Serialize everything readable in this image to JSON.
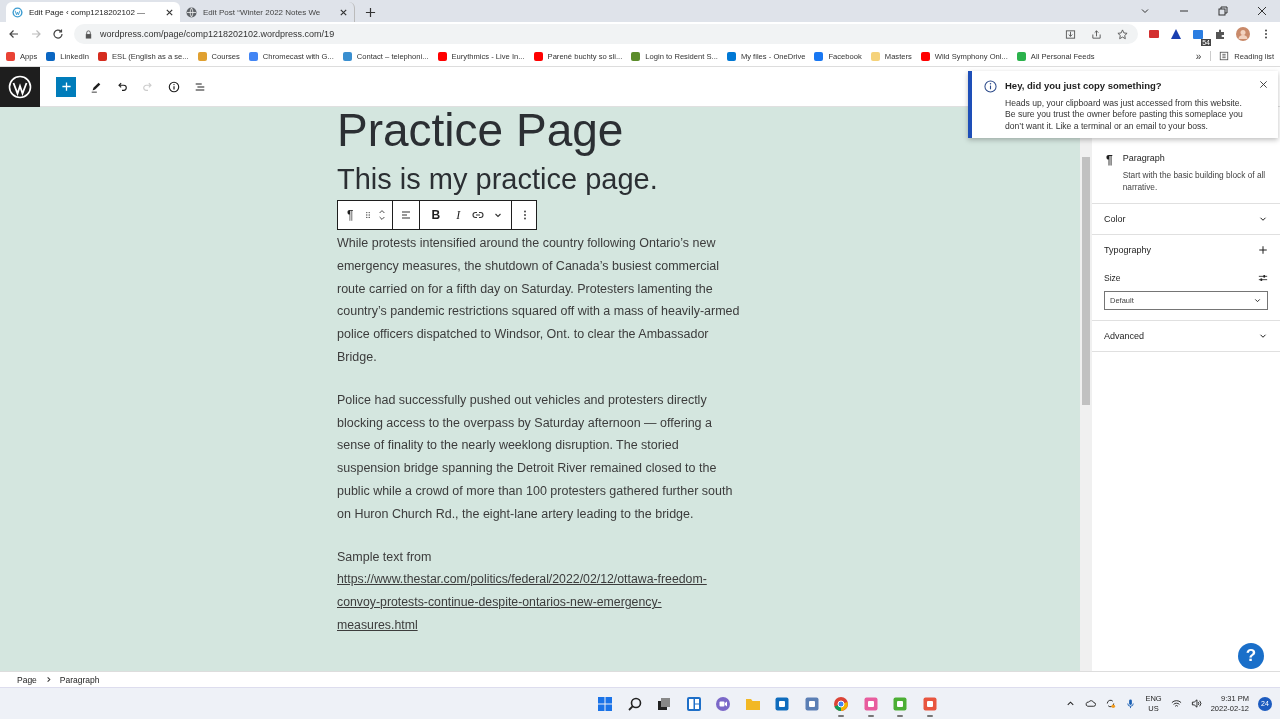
{
  "browser": {
    "tabs": [
      {
        "title": "Edit Page ‹ comp1218202102 —",
        "selected": true,
        "kind": "wp"
      },
      {
        "title": "Edit Post “Winter 2022 Notes We",
        "selected": false,
        "kind": "globe"
      }
    ],
    "url": "wordpress.com/page/comp1218202102.wordpress.com/19",
    "extension_badge": "54",
    "bookmarks": [
      {
        "label": "Apps",
        "color": "#e94235"
      },
      {
        "label": "LinkedIn",
        "color": "#0a66c2"
      },
      {
        "label": "ESL (English as a se...",
        "color": "#d52b1e"
      },
      {
        "label": "Courses",
        "color": "#e0a030"
      },
      {
        "label": "Chromecast with G...",
        "color": "#4285f4"
      },
      {
        "label": "Contact – telephoni...",
        "color": "#3a8fd0"
      },
      {
        "label": "Eurythmics - Live In...",
        "color": "#ff0000"
      },
      {
        "label": "Parené buchty so sli...",
        "color": "#ff0000"
      },
      {
        "label": "Login to Resident S...",
        "color": "#5b8c2a"
      },
      {
        "label": "My files - OneDrive",
        "color": "#0078d4"
      },
      {
        "label": "Facebook",
        "color": "#1877f2"
      },
      {
        "label": "Masters",
        "color": "#f5d27a"
      },
      {
        "label": "Wild Symphony Onl...",
        "color": "#ff0000"
      },
      {
        "label": "All Personal Feeds",
        "color": "#2bb24c"
      }
    ],
    "overflow": "»",
    "reading_list": "Reading list"
  },
  "editor": {
    "title": "Practice Page",
    "heading": "This is my practice page.",
    "toolbar": {
      "block_type": "¶",
      "bold": "B",
      "italic": "I"
    },
    "paragraphs": [
      "While protests intensified around the country following Ontario’s new emergency measures, the shutdown of Canada’s busiest commercial route carried on for a fifth day on Saturday. Protesters lamenting the country’s pandemic restrictions squared off with a mass of heavily-armed police officers dispatched to Windsor, Ont. to clear the Ambassador Bridge.",
      "Police had successfully pushed out vehicles and protesters directly blocking access to the overpass by Saturday afternoon — offering a sense of finality to the nearly weeklong disruption. The storied suspension bridge spanning the Detroit River remained closed to the public while a crowd of more than 100 protesters gathered further south on Huron Church Rd., the eight-lane artery leading to the bridge."
    ],
    "source_label": "Sample text from",
    "source_link": "https://www.thestar.com/politics/federal/2022/02/12/ottawa-freedom-convoy-protests-continue-despite-ontarios-new-emergency-measures.html"
  },
  "notice": {
    "title": "Hey, did you just copy something?",
    "body": "Heads up, your clipboard was just accessed from this website. Be sure you trust the owner before pasting this someplace you don’t want it. Like a terminal or an email to your boss."
  },
  "sidebar": {
    "block": {
      "icon": "¶",
      "name": "Paragraph",
      "description": "Start with the basic building block of all narrative."
    },
    "panels": [
      {
        "kind": "collapsed",
        "title": "Color"
      },
      {
        "kind": "tools",
        "title": "Typography",
        "size_label": "Size",
        "size_value": "Default"
      },
      {
        "kind": "collapsed",
        "title": "Advanced"
      }
    ]
  },
  "help": "?",
  "breadcrumb": [
    "Page",
    "Paragraph"
  ],
  "taskbar": {
    "apps": [
      {
        "kind": "start",
        "running": false
      },
      {
        "kind": "search",
        "running": false
      },
      {
        "kind": "taskview",
        "running": false
      },
      {
        "kind": "widgets",
        "running": false
      },
      {
        "kind": "chat",
        "running": false
      },
      {
        "kind": "folder",
        "running": false
      },
      {
        "kind": "tile",
        "color": "#0f6cbd",
        "running": false
      },
      {
        "kind": "tile",
        "color": "#5b7fb5",
        "running": false
      },
      {
        "kind": "browser",
        "running": true
      },
      {
        "kind": "tile",
        "color": "#e85d9e",
        "running": true
      },
      {
        "kind": "tile",
        "color": "#4caf35",
        "running": true
      },
      {
        "kind": "tile",
        "color": "#e8553f",
        "running": true
      }
    ],
    "lang": "ENG",
    "region": "US",
    "time": "9:31 PM",
    "date": "2022-02-12",
    "badge": "24"
  }
}
